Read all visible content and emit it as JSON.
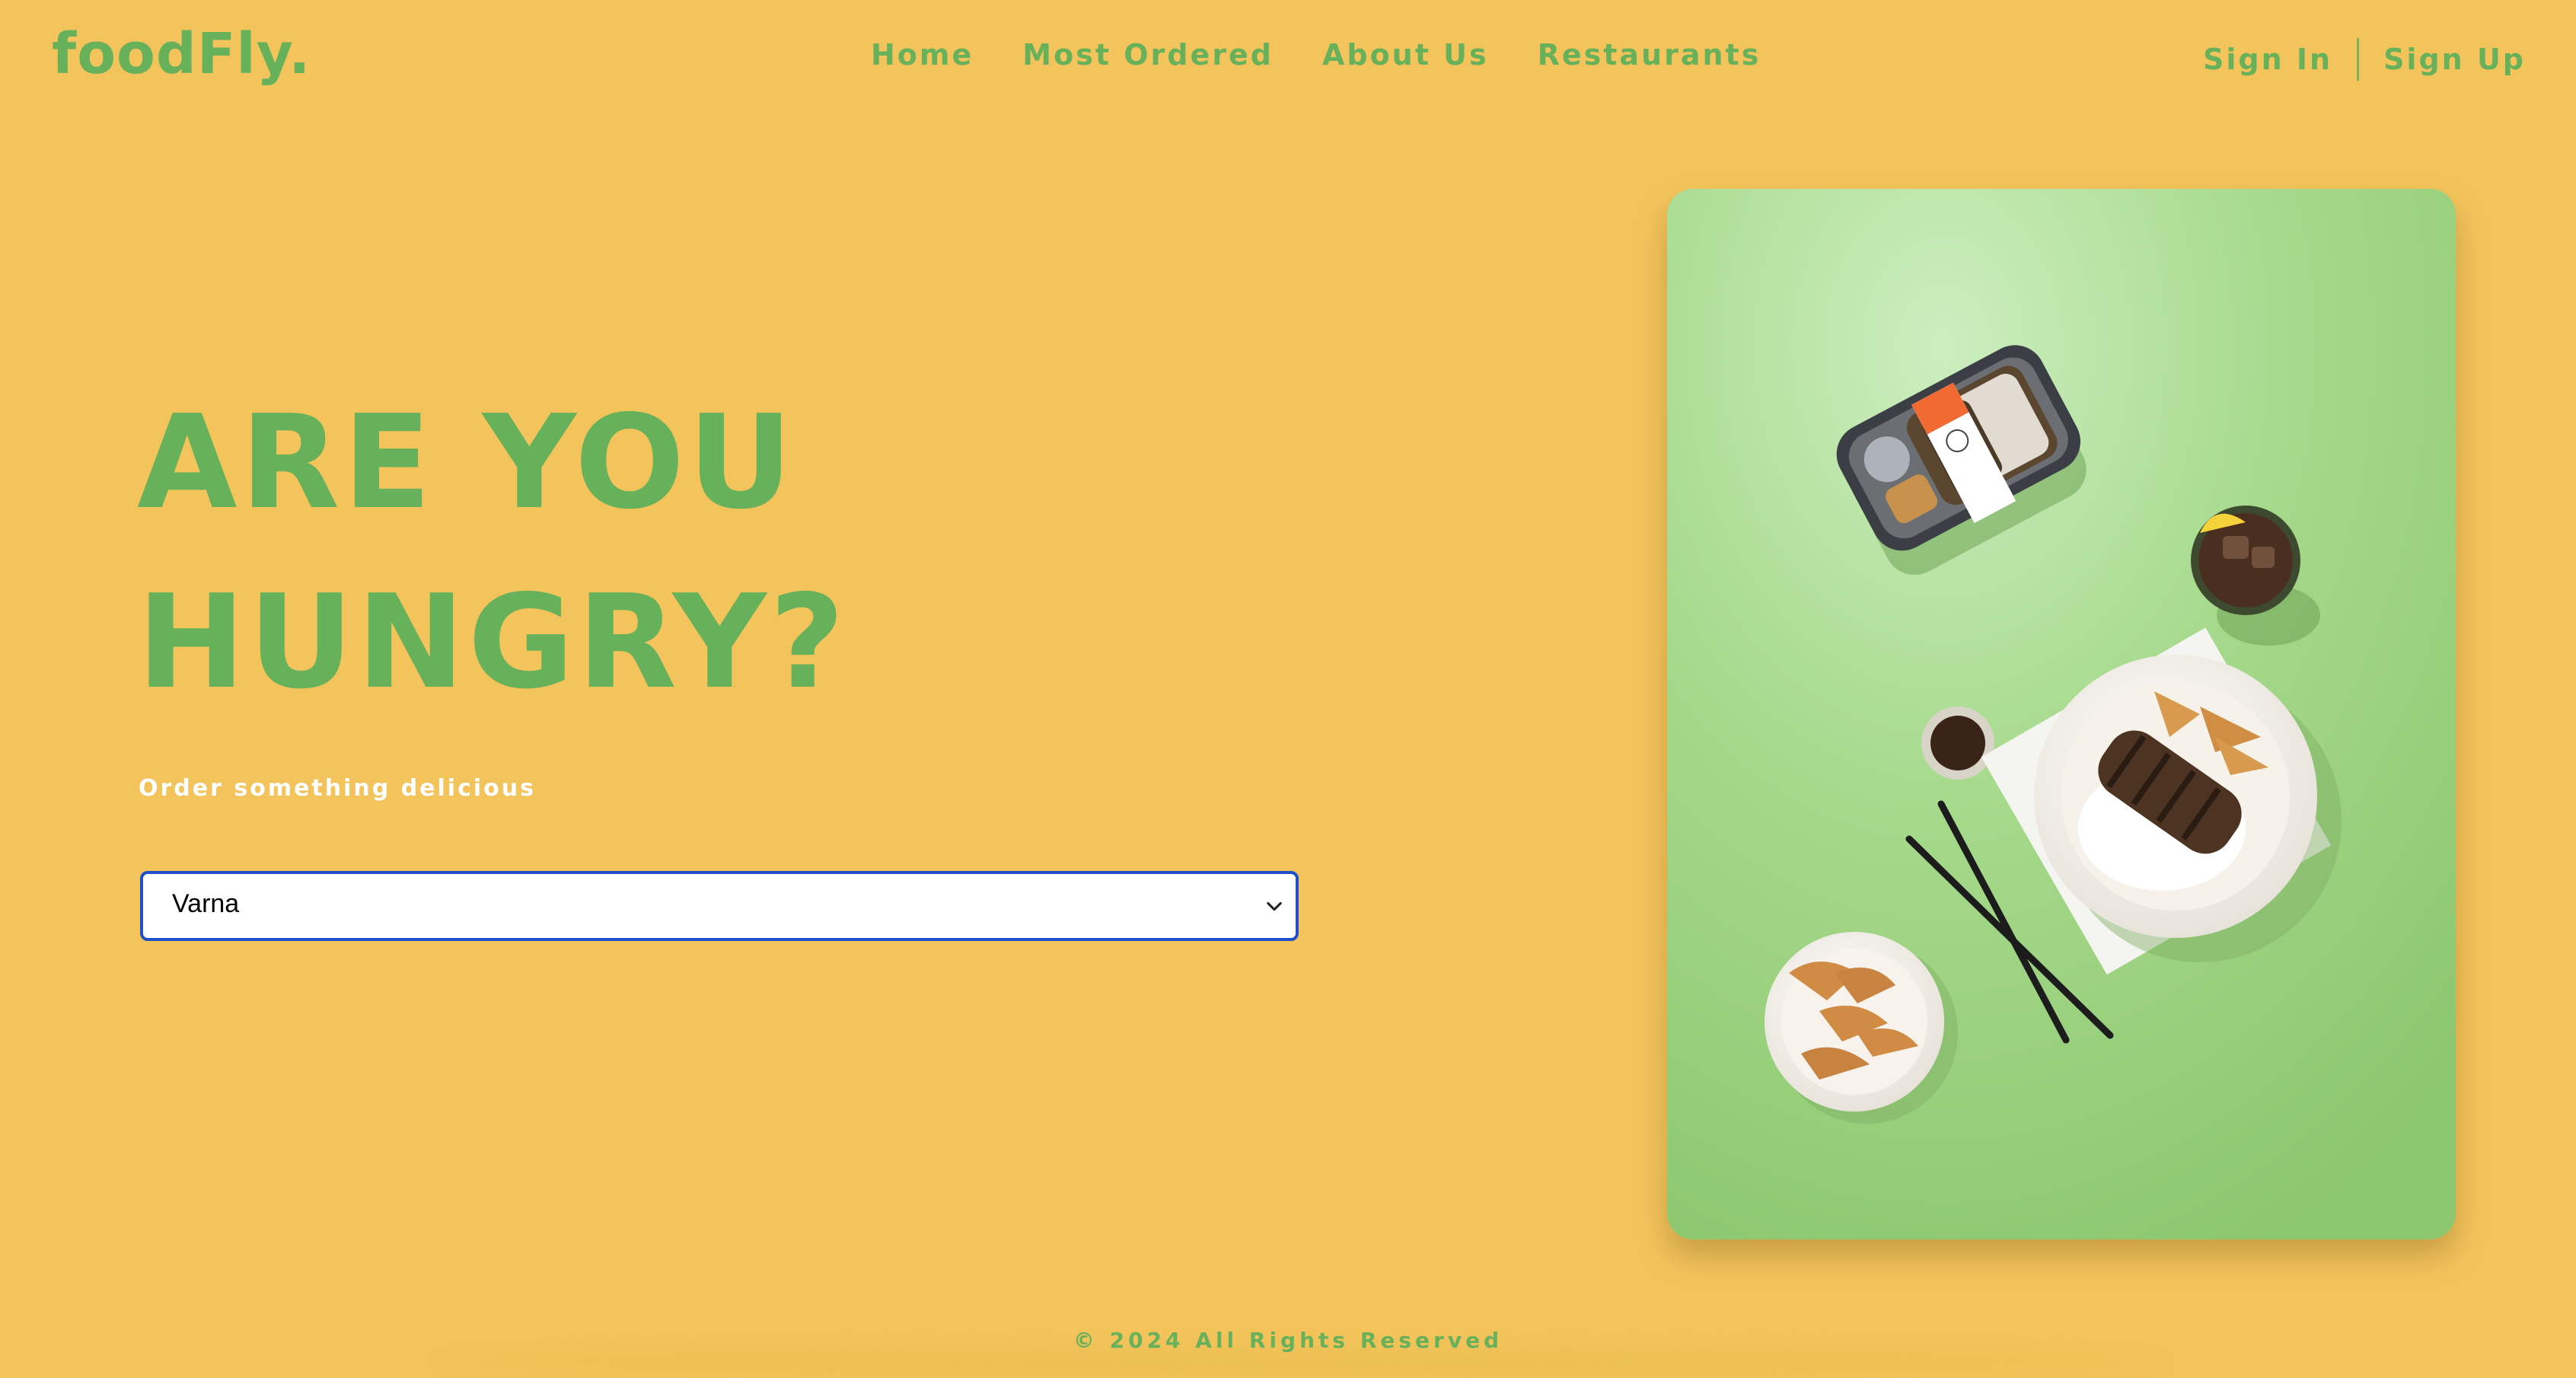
{
  "brand": {
    "logo": "foodFly."
  },
  "nav": {
    "items": [
      {
        "label": "Home"
      },
      {
        "label": "Most Ordered"
      },
      {
        "label": "About Us"
      },
      {
        "label": "Restaurants"
      }
    ]
  },
  "auth": {
    "sign_in": "Sign In",
    "sign_up": "Sign Up"
  },
  "hero": {
    "title_line1": "ARE YOU",
    "title_line2": "HUNGRY?",
    "subtitle": "Order something delicious"
  },
  "city_select": {
    "selected": "Varna"
  },
  "footer": {
    "copyright": "© 2024 All Rights Reserved"
  },
  "colors": {
    "background": "#f4c45c",
    "brand_green": "#67b15b",
    "select_border": "#1f50c8",
    "photo_bg": "#9bd27b"
  },
  "icons": {
    "select_arrow": "chevron-down-icon"
  }
}
